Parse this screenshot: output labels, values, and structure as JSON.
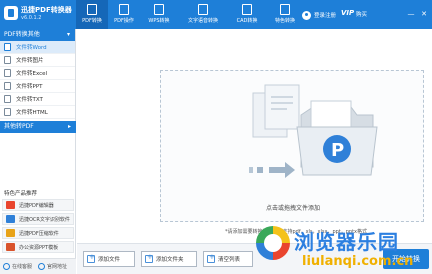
{
  "app": {
    "name": "迅捷PDF转换器",
    "version": "v6.0.1.2"
  },
  "tabs": [
    {
      "label": "PDF转换",
      "active": true
    },
    {
      "label": "PDF操作",
      "active": false
    },
    {
      "label": "WPS转换",
      "active": false
    },
    {
      "label": "文字语音转换",
      "active": false
    },
    {
      "label": "CAD转换",
      "active": false
    },
    {
      "label": "特色转换",
      "active": false
    }
  ],
  "header": {
    "login_label": "登录注册",
    "vip_label": "VIP",
    "buy_label": "购买",
    "minimize": "—",
    "close": "✕"
  },
  "sidebar": {
    "section1_title": "PDF转换其他",
    "section1_caret": "▾",
    "items": [
      {
        "label": "文件转Word",
        "active": true
      },
      {
        "label": "文件转图片",
        "active": false
      },
      {
        "label": "文件转Excel",
        "active": false
      },
      {
        "label": "文件转PPT",
        "active": false
      },
      {
        "label": "文件转TXT",
        "active": false
      },
      {
        "label": "文件转HTML",
        "active": false
      }
    ],
    "section2_title": "其他转PDF",
    "section2_caret": "▸",
    "recommend_title": "特色产品推荐",
    "recommend": [
      {
        "label": "迅捷PDF编辑器",
        "color": "#e9452e"
      },
      {
        "label": "迅捷OCR文字识别软件",
        "color": "#2f80d8"
      },
      {
        "label": "迅捷PDF压缩软件",
        "color": "#e8a318"
      },
      {
        "label": "办公资源PPT模板",
        "color": "#d9532c"
      }
    ],
    "bottom_links": [
      "在线客服",
      "官网地址"
    ]
  },
  "main": {
    "drop_text": "点击或拖拽文件添加",
    "hint_text": "*请添加需要转换的文件，支持pdf，xls，xlsx，ppt，pptx格式"
  },
  "bottom_bar": {
    "add_file": "添加文件",
    "add_folder": "添加文件夹",
    "clear_list": "清空列表",
    "start": "开始转换"
  },
  "watermark": {
    "cn": "浏览器乐园",
    "en": "liulanqi.com.cn"
  },
  "colors": {
    "primary": "#1e7fd8",
    "primary_dark": "#1567b8",
    "active_item_bg": "#dcebfa"
  }
}
